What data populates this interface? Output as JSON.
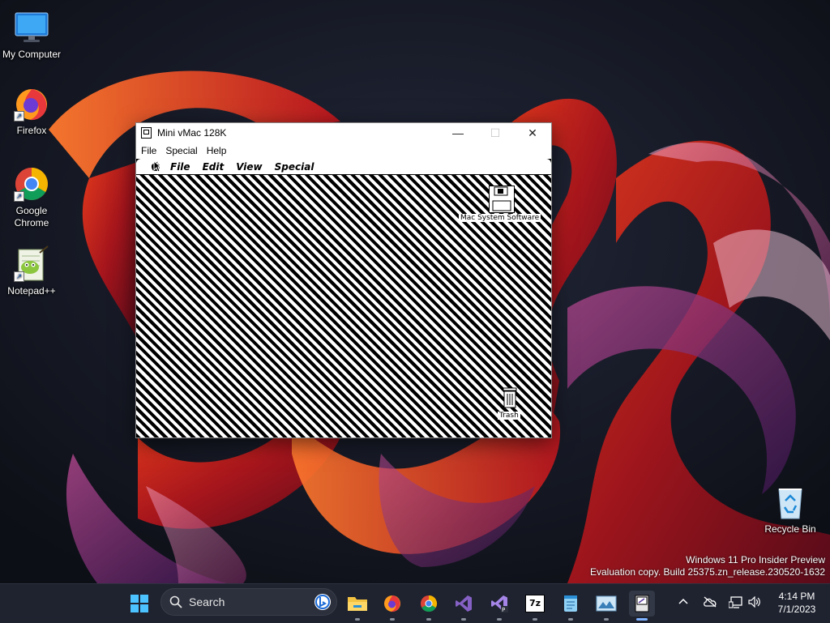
{
  "desktop": {
    "icons": [
      {
        "label": "My Computer",
        "icon": "monitor-icon"
      },
      {
        "label": "Firefox",
        "icon": "firefox-icon"
      },
      {
        "label": "Google Chrome",
        "icon": "chrome-icon"
      },
      {
        "label": "Notepad++",
        "icon": "notepadpp-icon"
      },
      {
        "label": "Recycle Bin",
        "icon": "recycle-bin-icon"
      }
    ],
    "watermark": {
      "line1": "Windows 11 Pro Insider Preview",
      "line2": "Evaluation copy. Build 25375.zn_release.230520-1632"
    }
  },
  "window": {
    "title": "Mini vMac 128K",
    "controls": {
      "minimize": "—",
      "maximize": "☐",
      "close": "✕"
    },
    "menu": [
      "File",
      "Special",
      "Help"
    ]
  },
  "mac": {
    "menu": [
      "File",
      "Edit",
      "View",
      "Special"
    ],
    "disk_label": "Mac System Software",
    "trash_label": "Trash"
  },
  "taskbar": {
    "search_placeholder": "Search",
    "apps": [
      "start-icon",
      "file-explorer-icon",
      "firefox-icon",
      "chrome-icon",
      "visual-studio-icon",
      "visual-studio-preview-icon",
      "7zip-icon",
      "notepad-icon",
      "paint-icon",
      "mini-vmac-icon"
    ],
    "seven_zip_label": "7z",
    "time": "4:14 PM",
    "date": "7/1/2023"
  },
  "colors": {
    "accent": "#0078d4",
    "taskbar": "#1f2330",
    "wallpaper_dark": "#14161f",
    "wallpaper_red": "#c8201a"
  }
}
